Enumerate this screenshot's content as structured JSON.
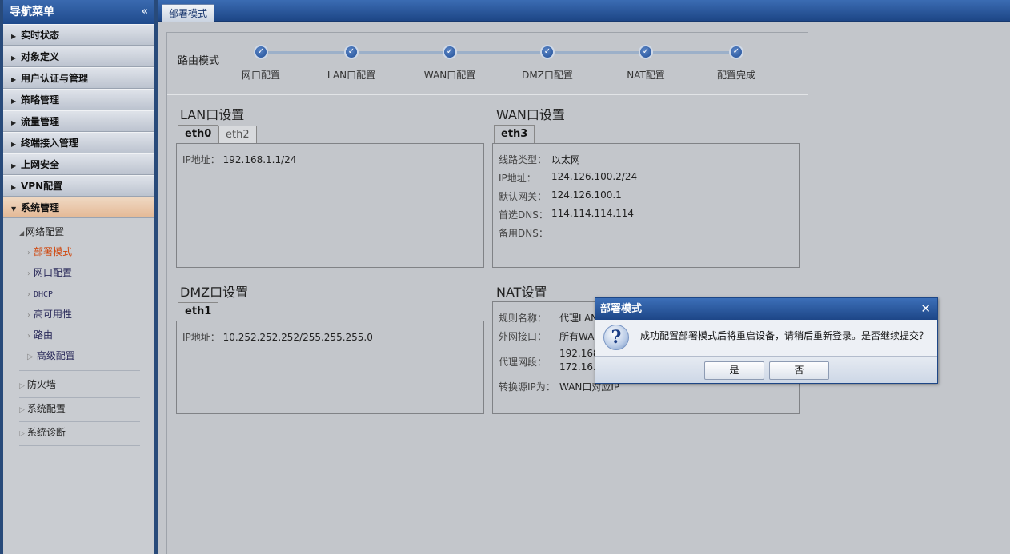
{
  "sidebar": {
    "title": "导航菜单",
    "collapse": "«",
    "items": [
      {
        "label": "实时状态"
      },
      {
        "label": "对象定义"
      },
      {
        "label": "用户认证与管理"
      },
      {
        "label": "策略管理"
      },
      {
        "label": "流量管理"
      },
      {
        "label": "终端接入管理"
      },
      {
        "label": "上网安全"
      },
      {
        "label": "VPN配置"
      },
      {
        "label": "系统管理"
      }
    ],
    "tree": {
      "group": "网络配置",
      "leaves": [
        "部署模式",
        "网口配置",
        "DHCP",
        "高可用性",
        "路由",
        "高级配置"
      ],
      "groups2": [
        "防火墙",
        "系统配置",
        "系统诊断"
      ]
    }
  },
  "tabs": {
    "active": "部署模式"
  },
  "steps": {
    "title": "路由模式",
    "items": [
      "网口配置",
      "LAN口配置",
      "WAN口配置",
      "DMZ口配置",
      "NAT配置",
      "配置完成"
    ]
  },
  "lan": {
    "title": "LAN口设置",
    "tabs": [
      "eth0",
      "eth2"
    ],
    "ip_label": "IP地址：",
    "ip": "192.168.1.1/24"
  },
  "wan": {
    "title": "WAN口设置",
    "tab": "eth3",
    "rows": [
      {
        "k": "线路类型：",
        "v": "以太网"
      },
      {
        "k": "IP地址：",
        "v": "124.126.100.2/24"
      },
      {
        "k": "默认网关：",
        "v": "124.126.100.1"
      },
      {
        "k": "首选DNS：",
        "v": "114.114.114.114"
      },
      {
        "k": "备用DNS：",
        "v": ""
      }
    ]
  },
  "dmz": {
    "title": "DMZ口设置",
    "tab": "eth1",
    "ip_label": "IP地址：",
    "ip": "10.252.252.252/255.255.255.0"
  },
  "nat": {
    "title": "NAT设置",
    "rows": [
      {
        "k": "规则名称：",
        "v": "代理LAN"
      },
      {
        "k": "外网接口：",
        "v": "所有WA"
      },
      {
        "k": "代理网段：",
        "v": "192.168",
        "v2": "172.16.0"
      },
      {
        "k": "转换源IP为：",
        "v": "WAN口对应IP"
      }
    ]
  },
  "dialog": {
    "title": "部署模式",
    "close": "✕",
    "message": "成功配置部署模式后将重启设备，请稍后重新登录。是否继续提交？",
    "icon": "?",
    "yes": "是",
    "no": "否"
  },
  "colors": {
    "accent": "#1d4686",
    "current_leaf": "#d0450a"
  }
}
